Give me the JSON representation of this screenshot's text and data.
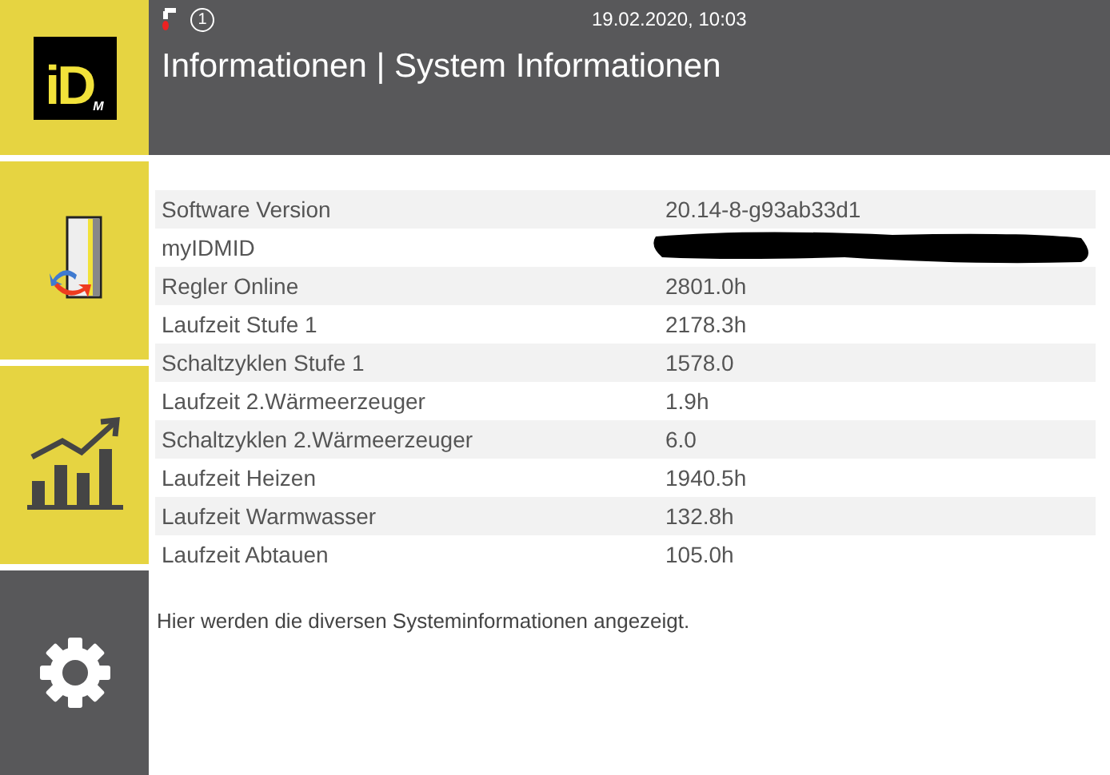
{
  "header": {
    "status_icons": [
      {
        "kind": "tap"
      },
      {
        "kind": "badge",
        "text": "1"
      }
    ],
    "datetime": "19.02.2020, 10:03",
    "title": "Informationen | System Informationen"
  },
  "nav": [
    {
      "kind": "logo",
      "text": "iD",
      "sub": "M",
      "selected": false
    },
    {
      "kind": "door",
      "selected": false
    },
    {
      "kind": "chart",
      "selected": false
    },
    {
      "kind": "gear",
      "selected": true
    }
  ],
  "rows": [
    {
      "label": "Software Version",
      "value": "20.14-8-g93ab33d1"
    },
    {
      "label": "myIDMID",
      "kind": "redacted"
    },
    {
      "label": "Regler Online",
      "value": "2801.0h"
    },
    {
      "label": "Laufzeit Stufe 1",
      "value": "2178.3h"
    },
    {
      "label": "Schaltzyklen Stufe 1",
      "value": "1578.0"
    },
    {
      "label": "Laufzeit 2.Wärmeerzeuger",
      "value": "1.9h"
    },
    {
      "label": "Schaltzyklen 2.Wärmeerzeuger",
      "value": "6.0"
    },
    {
      "label": "Laufzeit Heizen",
      "value": "1940.5h"
    },
    {
      "label": "Laufzeit Warmwasser",
      "value": "132.8h"
    },
    {
      "label": "Laufzeit Abtauen",
      "value": "105.0h"
    }
  ],
  "description": "Hier werden die diversen Systeminformationen angezeigt."
}
